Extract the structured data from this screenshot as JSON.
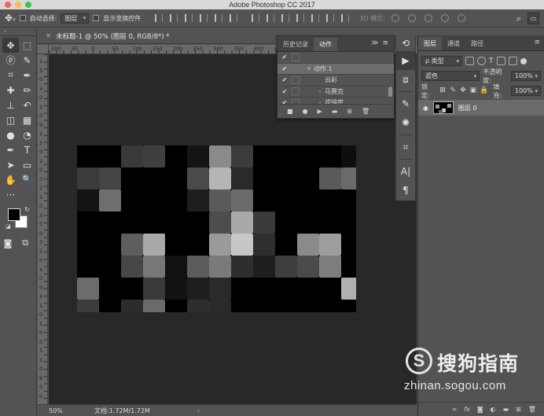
{
  "window": {
    "title": "Adobe Photoshop CC 2017",
    "traffic_lights": [
      "#fc605c",
      "#fdbc40",
      "#34c84a"
    ]
  },
  "options_bar": {
    "auto_select_label": "自动选择:",
    "auto_select_value": "图层",
    "show_transform_label": "显示变换控件",
    "mode_3d_label": "3D 模式:"
  },
  "document": {
    "tab_title": "未标题-1 @ 50% (图层 0, RGB/8*) *",
    "close_glyph": "×",
    "ruler_top": [
      "100",
      "50",
      "0",
      "50",
      "100",
      "150",
      "200",
      "250",
      "300",
      "350",
      "400",
      "450",
      "500",
      "550",
      "600",
      "650",
      "700",
      "750"
    ],
    "ruler_left": [
      "1",
      "5",
      "0",
      "5",
      "0",
      "1",
      "0",
      "0",
      "1",
      "5",
      "0",
      "2",
      "0",
      "0",
      "2",
      "5",
      "0",
      "3",
      "0",
      "0",
      "3",
      "5",
      "0",
      "4",
      "0",
      "0",
      "4",
      "5",
      "0",
      "5",
      "0",
      "0",
      "5",
      "5",
      "0",
      "6",
      "0",
      "0"
    ]
  },
  "status_bar": {
    "zoom": "50%",
    "doc_info": "文档:1.72M/1.72M",
    "arrow": "›"
  },
  "actions_panel": {
    "tabs": [
      "历史记录",
      "动作"
    ],
    "active_tab": 1,
    "menu_glyph": "≫  ≡",
    "rows": [
      {
        "label": "",
        "indent": 1,
        "caret": "",
        "selected": false
      },
      {
        "label": "动作 1",
        "indent": 1,
        "caret": "∨",
        "selected": true
      },
      {
        "label": "云彩",
        "indent": 2,
        "caret": "",
        "selected": false
      },
      {
        "label": "马赛克",
        "indent": 2,
        "caret": "›",
        "selected": false
      },
      {
        "label": "滤镜库",
        "indent": 2,
        "caret": "›",
        "selected": false
      }
    ],
    "footer_icons": [
      "stop-icon",
      "record-icon",
      "play-icon",
      "folder-icon",
      "new-action-icon",
      "trash-icon"
    ]
  },
  "layers_panel": {
    "tabs": [
      "图层",
      "通道",
      "路径"
    ],
    "active_tab": 0,
    "filter_kind": "ρ 类型",
    "blend_mode": "滤色",
    "opacity_label": "不透明度:",
    "opacity_value": "100%",
    "lock_label": "锁定:",
    "fill_label": "填充:",
    "fill_value": "100%",
    "layers": [
      {
        "name": "图层 0",
        "visible": true
      }
    ],
    "eye_glyph": "👁",
    "footer_icons": [
      "link-icon",
      "fx-icon",
      "mask-icon",
      "adjustment-icon",
      "group-icon",
      "new-layer-icon",
      "trash-icon"
    ]
  },
  "watermark": {
    "logo_letter": "S",
    "brand": "搜狗指南",
    "url": "zhinan.sogou.com"
  },
  "icons": {
    "move": "✥",
    "marquee": "⬚",
    "lasso": "ⓟ",
    "quick_select": "✎",
    "crop": "⌗",
    "eyedropper": "✒",
    "heal": "✚",
    "brush": "✏",
    "stamp": "⊥",
    "history_brush": "↶",
    "eraser": "◫",
    "gradient": "▦",
    "blur": "●",
    "dodge": "◔",
    "pen": "✒",
    "type": "T",
    "path_select": "➤",
    "shape": "▭",
    "hand": "✋",
    "zoom": "🔍",
    "more": "···",
    "quickmask": "◙",
    "screenmode": "⧉"
  }
}
